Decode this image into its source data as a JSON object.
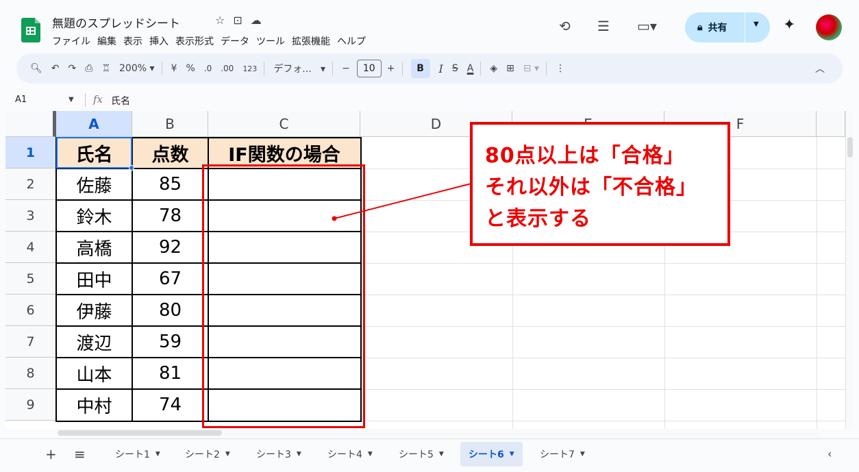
{
  "header": {
    "title": "無題のスプレッドシート",
    "title_icons": [
      "star-icon",
      "move-to-folder-icon",
      "cloud-status-icon"
    ],
    "menu": [
      "ファイル",
      "編集",
      "表示",
      "挿入",
      "表示形式",
      "データ",
      "ツール",
      "拡張機能",
      "ヘルプ"
    ],
    "share_label": "共有"
  },
  "toolbar": {
    "zoom": "200%",
    "currency": "¥",
    "percent": "%",
    "decimal_decrease": ".0",
    "decimal_increase": ".00",
    "number_format": "123",
    "font_name": "デフォ...",
    "font_size": "10",
    "bold": "B",
    "italic": "I",
    "text_color": "A"
  },
  "formula_bar": {
    "cell_ref": "A1",
    "content": "氏名"
  },
  "grid": {
    "columns": [
      "A",
      "B",
      "C",
      "D",
      "E",
      "F"
    ],
    "rows": [
      "1",
      "2",
      "3",
      "4",
      "5",
      "6",
      "7",
      "8",
      "9"
    ],
    "headers": [
      "氏名",
      "点数",
      "IF関数の場合"
    ],
    "data": [
      {
        "name": "佐藤",
        "score": "85"
      },
      {
        "name": "鈴木",
        "score": "78"
      },
      {
        "name": "高橋",
        "score": "92"
      },
      {
        "name": "田中",
        "score": "67"
      },
      {
        "name": "伊藤",
        "score": "80"
      },
      {
        "name": "渡辺",
        "score": "59"
      },
      {
        "name": "山本",
        "score": "81"
      },
      {
        "name": "中村",
        "score": "74"
      }
    ]
  },
  "callout": {
    "lines": [
      "80点以上は「合格」",
      "それ以外は「不合格」",
      "と表示する"
    ]
  },
  "sheets": {
    "tabs": [
      "シート1",
      "シート2",
      "シート3",
      "シート4",
      "シート5",
      "シート6",
      "シート7"
    ],
    "active": "シート6"
  },
  "colors": {
    "header_fill": "#fce5cd",
    "annotation_red": "#e00000",
    "share_button": "#c2e7ff",
    "logo_green": "#0f9d58"
  }
}
